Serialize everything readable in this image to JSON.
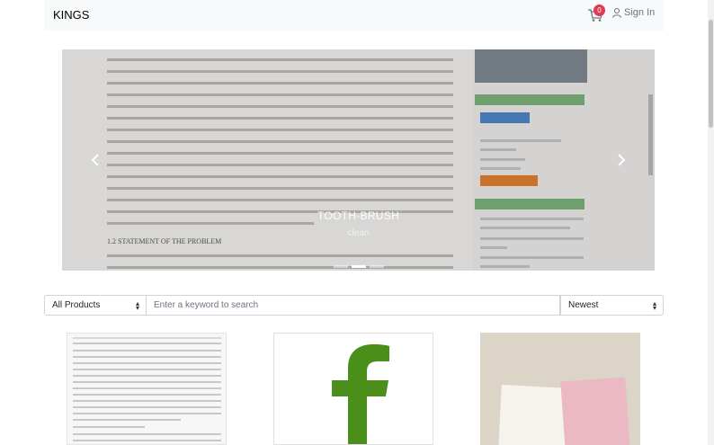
{
  "navbar": {
    "brand": "KINGS",
    "cart_count": "0",
    "signin_label": "Sign In"
  },
  "carousel": {
    "caption_title": "TOOTH-BRUSH",
    "caption_subtitle": "clean",
    "slide_count": 3,
    "active_slide": 1,
    "document": {
      "heading": "1.2    STATEMENT  OF  THE PROBLEM"
    }
  },
  "filter": {
    "category_selected": "All Products",
    "search_placeholder": "Enter a keyword to search",
    "sort_selected": "Newest"
  },
  "colors": {
    "badge": "#e03a55",
    "facebook_green": "#4a8f1a"
  },
  "icons": {
    "cart": "shopping-cart-icon",
    "user": "user-icon",
    "prev": "chevron-left-icon",
    "next": "chevron-right-icon"
  }
}
